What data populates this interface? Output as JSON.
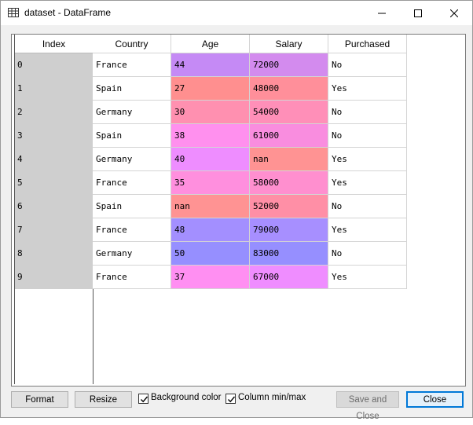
{
  "window": {
    "title": "dataset - DataFrame"
  },
  "table": {
    "index_header": "Index",
    "columns": [
      "Country",
      "Age",
      "Salary",
      "Purchased"
    ],
    "rows": [
      {
        "index": "0",
        "cells": [
          "France",
          "44",
          "72000",
          "No"
        ],
        "colors": [
          "#ffffff",
          "#c58af5",
          "#d38bee",
          "#ffffff"
        ]
      },
      {
        "index": "1",
        "cells": [
          "Spain",
          "27",
          "48000",
          "Yes"
        ],
        "colors": [
          "#ffffff",
          "#ff8f8f",
          "#ff8f9a",
          "#ffffff"
        ]
      },
      {
        "index": "2",
        "cells": [
          "Germany",
          "30",
          "54000",
          "No"
        ],
        "colors": [
          "#ffffff",
          "#ff90b0",
          "#ff8fb8",
          "#ffffff"
        ]
      },
      {
        "index": "3",
        "cells": [
          "Spain",
          "38",
          "61000",
          "No"
        ],
        "colors": [
          "#ffffff",
          "#ff90ee",
          "#f98ddf",
          "#ffffff"
        ]
      },
      {
        "index": "4",
        "cells": [
          "Germany",
          "40",
          "nan",
          "Yes"
        ],
        "colors": [
          "#ffffff",
          "#ee8dff",
          "#ff9393",
          "#ffffff"
        ]
      },
      {
        "index": "5",
        "cells": [
          "France",
          "35",
          "58000",
          "Yes"
        ],
        "colors": [
          "#ffffff",
          "#ff8fde",
          "#ff8fcf",
          "#ffffff"
        ]
      },
      {
        "index": "6",
        "cells": [
          "Spain",
          "nan",
          "52000",
          "No"
        ],
        "colors": [
          "#ffffff",
          "#ff9393",
          "#ff8fa6",
          "#ffffff"
        ]
      },
      {
        "index": "7",
        "cells": [
          "France",
          "48",
          "79000",
          "Yes"
        ],
        "colors": [
          "#ffffff",
          "#a38fff",
          "#a78fff",
          "#ffffff"
        ]
      },
      {
        "index": "8",
        "cells": [
          "Germany",
          "50",
          "83000",
          "No"
        ],
        "colors": [
          "#ffffff",
          "#968fff",
          "#968fff",
          "#ffffff"
        ]
      },
      {
        "index": "9",
        "cells": [
          "France",
          "37",
          "67000",
          "Yes"
        ],
        "colors": [
          "#ffffff",
          "#ff8ff2",
          "#ef8dff",
          "#ffffff"
        ]
      }
    ]
  },
  "footer": {
    "format_label": "Format",
    "resize_label": "Resize",
    "bg_color_label": "Background color",
    "bg_color_checked": true,
    "minmax_label": "Column min/max",
    "minmax_checked": true,
    "save_close_label": "Save and Close",
    "close_label": "Close"
  }
}
